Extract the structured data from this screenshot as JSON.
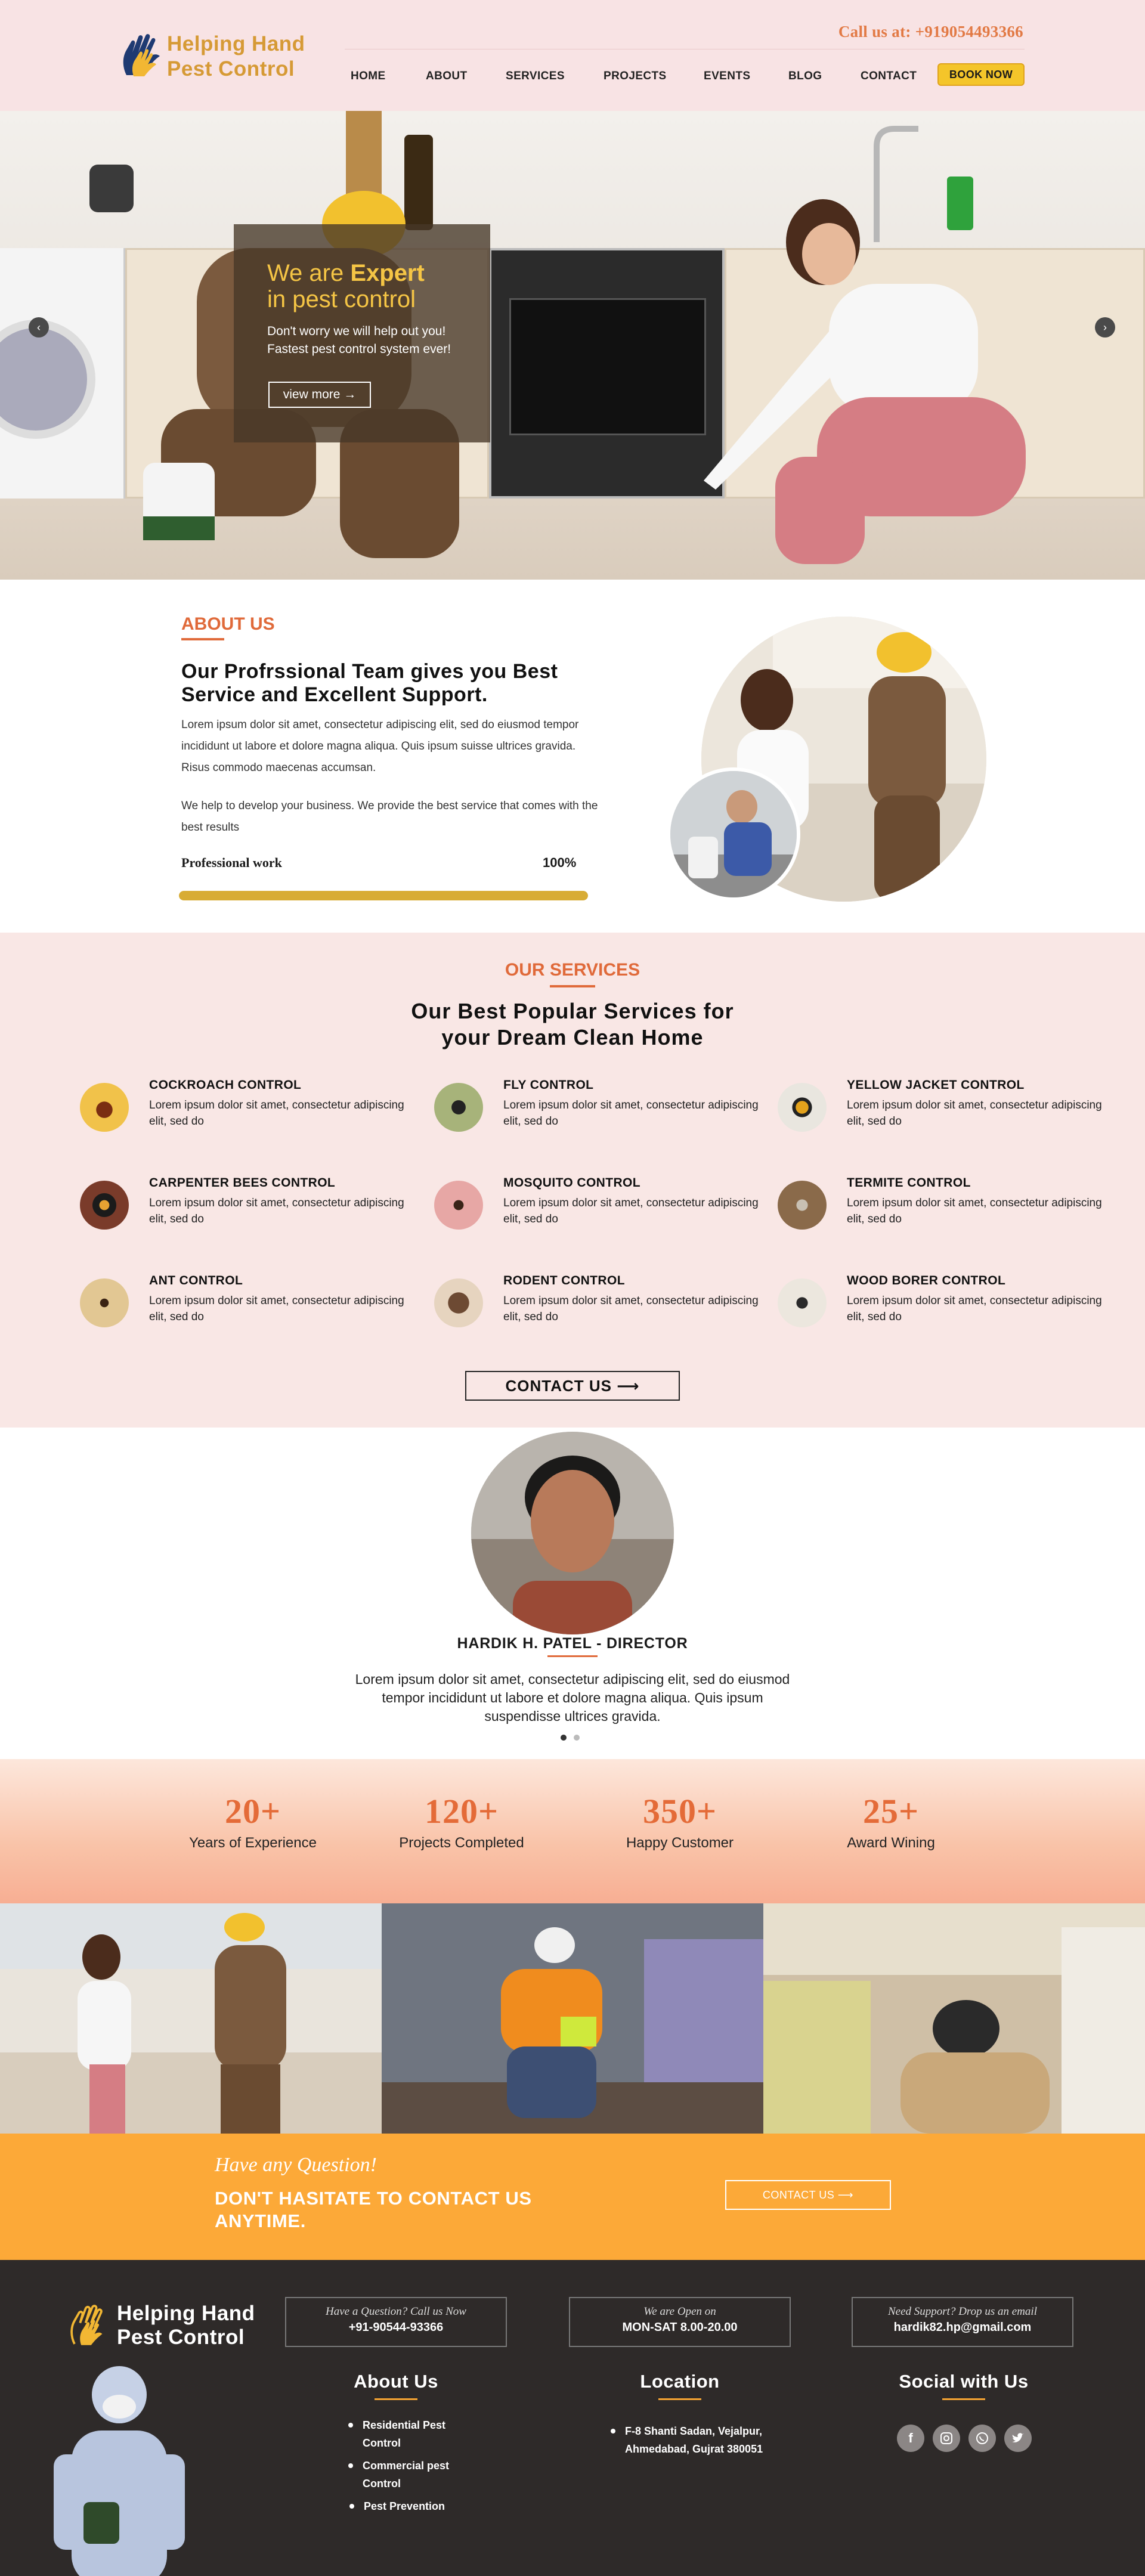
{
  "header": {
    "logo_line1": "Helping Hand",
    "logo_line2": "Pest Control",
    "call_text": "Call us at: +919054493366",
    "nav": [
      "HOME",
      "ABOUT",
      "SERVICES",
      "PROJECTS",
      "EVENTS",
      "BLOG",
      "CONTACT"
    ],
    "book_label": "BOOK NOW"
  },
  "hero": {
    "title_pre": "We are ",
    "title_bold": "Expert",
    "title_line2": "in pest control",
    "sub1": "Don't worry we will help out you!",
    "sub2": "Fastest pest control system ever!",
    "button": "view more →",
    "prev_icon": "chevron-left-icon",
    "next_icon": "chevron-right-icon"
  },
  "about": {
    "heading": "ABOUT US",
    "title": "Our Profrssional Team gives you Best Service and Excellent Support.",
    "p1": "Lorem ipsum dolor sit amet, consectetur adipiscing elit, sed do eiusmod tempor incididunt ut labore et dolore magna aliqua. Quis ipsum suisse ultrices gravida. Risus commodo maecenas accumsan.",
    "p2": "We help to develop your business. We provide the best service that comes with the best results",
    "skill_label": "Professional work",
    "skill_value": "100%",
    "skill_fraction": 1.0
  },
  "services": {
    "heading": "OUR SERVICES",
    "title_line1": "Our Best Popular Services for",
    "title_line2": "your Dream Clean Home",
    "items": [
      {
        "name": "COCKROACH CONTROL",
        "desc": "Lorem ipsum dolor sit amet, consectetur adipiscing elit, sed do"
      },
      {
        "name": "FLY CONTROL",
        "desc": "Lorem ipsum dolor sit amet, consectetur adipiscing elit, sed do"
      },
      {
        "name": "YELLOW JACKET CONTROL",
        "desc": "Lorem ipsum dolor sit amet, consectetur adipiscing elit, sed do"
      },
      {
        "name": "CARPENTER BEES CONTROL",
        "desc": "Lorem ipsum dolor sit amet, consectetur adipiscing elit, sed do"
      },
      {
        "name": "MOSQUITO CONTROL",
        "desc": "Lorem ipsum dolor sit amet, consectetur adipiscing elit, sed do"
      },
      {
        "name": "TERMITE CONTROL",
        "desc": "Lorem ipsum dolor sit amet, consectetur adipiscing elit, sed do"
      },
      {
        "name": "ANT CONTROL",
        "desc": "Lorem ipsum dolor sit amet, consectetur adipiscing elit, sed do"
      },
      {
        "name": "RODENT CONTROL",
        "desc": "Lorem ipsum dolor sit amet, consectetur adipiscing elit, sed do"
      },
      {
        "name": "WOOD BORER CONTROL",
        "desc": "Lorem ipsum dolor sit amet, consectetur adipiscing elit, sed do"
      }
    ],
    "button": "CONTACT US ⟶"
  },
  "testimonial": {
    "name": "HARDIK H. PATEL - DIRECTOR",
    "text": "Lorem ipsum dolor sit amet, consectetur adipiscing elit, sed do eiusmod tempor incididunt ut labore et dolore magna aliqua. Quis ipsum suspendisse ultrices gravida."
  },
  "stats": [
    {
      "value": "20+",
      "label": "Years of Experience"
    },
    {
      "value": "120+",
      "label": "Projects Completed"
    },
    {
      "value": "350+",
      "label": "Happy Customer"
    },
    {
      "value": "25+",
      "label": "Award Wining"
    }
  ],
  "cta": {
    "question": "Have any Question!",
    "headline": "DON'T HASITATE TO CONTACT US ANYTIME.",
    "button": "CONTACT US ⟶"
  },
  "footer": {
    "logo_line1": "Helping Hand",
    "logo_line2": "Pest Control",
    "boxes": [
      {
        "label": "Have a Question? Call us Now",
        "value": "+91-90544-93366"
      },
      {
        "label": "We are Open on",
        "value": "MON-SAT 8.00-20.00"
      },
      {
        "label": "Need Support? Drop us an email",
        "value": "hardik82.hp@gmail.com"
      }
    ],
    "about_heading": "About Us",
    "about_links": [
      "Residential Pest Control",
      "Commercial pest Control",
      "Pest Prevention"
    ],
    "location_heading": "Location",
    "address": "F-8 Shanti Sadan, Vejalpur, Ahmedabad, Gujrat 380051",
    "social_heading": "Social with Us",
    "social_icons": [
      "facebook-icon",
      "instagram-icon",
      "whatsapp-icon",
      "twitter-icon"
    ]
  },
  "colors": {
    "accent_orange": "#e06a3a",
    "gold": "#d8ac34",
    "cta_orange": "#fca938",
    "footer_bg": "#2e2a29",
    "header_bg": "#f8e3e4"
  }
}
